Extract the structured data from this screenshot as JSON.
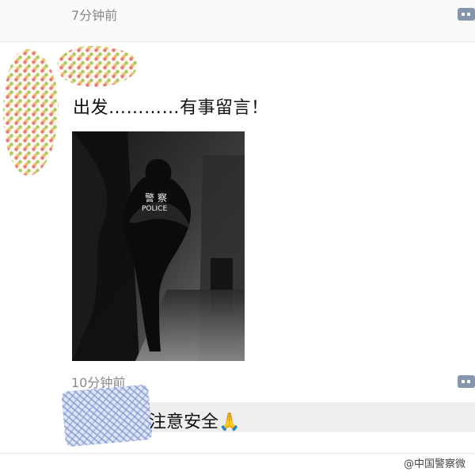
{
  "feed": {
    "top": {
      "time": "7分钟前"
    },
    "post": {
      "text": "出发…………有事留言！",
      "image_caption": "警察 POLICE"
    },
    "comment": {
      "time": "10分钟前",
      "text": "注意安全🙏"
    },
    "watermark": "@中国警察微"
  },
  "icons": {
    "comment_icon": "comment-icon",
    "avatar": "avatar"
  },
  "colors": {
    "page_bg": "#ffffff",
    "divider": "#e6e6e6",
    "comment_bg": "#eeeeee",
    "icon": "#8796ad",
    "muted_text": "#888888"
  }
}
